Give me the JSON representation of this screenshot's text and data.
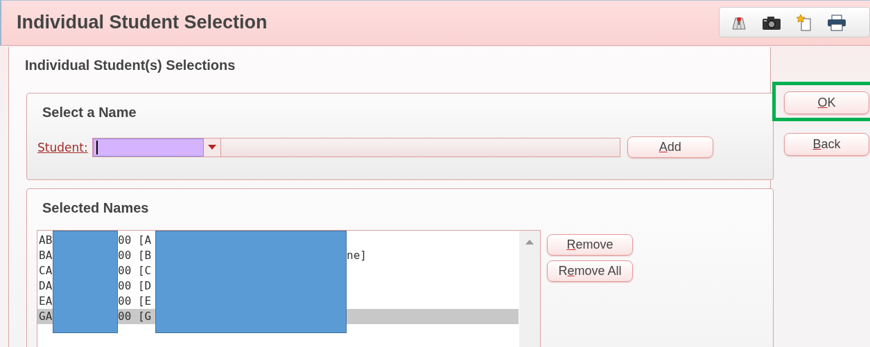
{
  "title": "Individual Student Selection",
  "toolbar": [
    {
      "kind": "map"
    },
    {
      "kind": "camera"
    },
    {
      "kind": "note"
    },
    {
      "kind": "printer"
    }
  ],
  "subtitle": "Individual Student(s) Selections",
  "select_panel": {
    "heading": "Select a Name",
    "student_label": "Student:",
    "add_button": {
      "key": "A",
      "after": "dd"
    }
  },
  "selected_panel": {
    "heading": "Selected Names",
    "rows": [
      {
        "prefix": "AB",
        "middle": "00 [A",
        "selected": false
      },
      {
        "prefix": "BA",
        "middle": "00 [B",
        "suffix": "ne]",
        "selected": false
      },
      {
        "prefix": "CA",
        "middle": "00 [C",
        "selected": false
      },
      {
        "prefix": "DA",
        "middle": "00 [D",
        "selected": false
      },
      {
        "prefix": "EA",
        "middle": "00 [E",
        "selected": false
      },
      {
        "prefix": "GA",
        "middle": "00 [G",
        "selected": true
      }
    ],
    "buttons": [
      {
        "key": "R",
        "after": "emove"
      },
      {
        "before": "R",
        "key": "e",
        "after": "move All"
      }
    ]
  },
  "side_buttons": [
    {
      "key": "O",
      "after": "K",
      "highlighted": true
    },
    {
      "key": "B",
      "after": "ack",
      "highlighted": false
    }
  ]
}
